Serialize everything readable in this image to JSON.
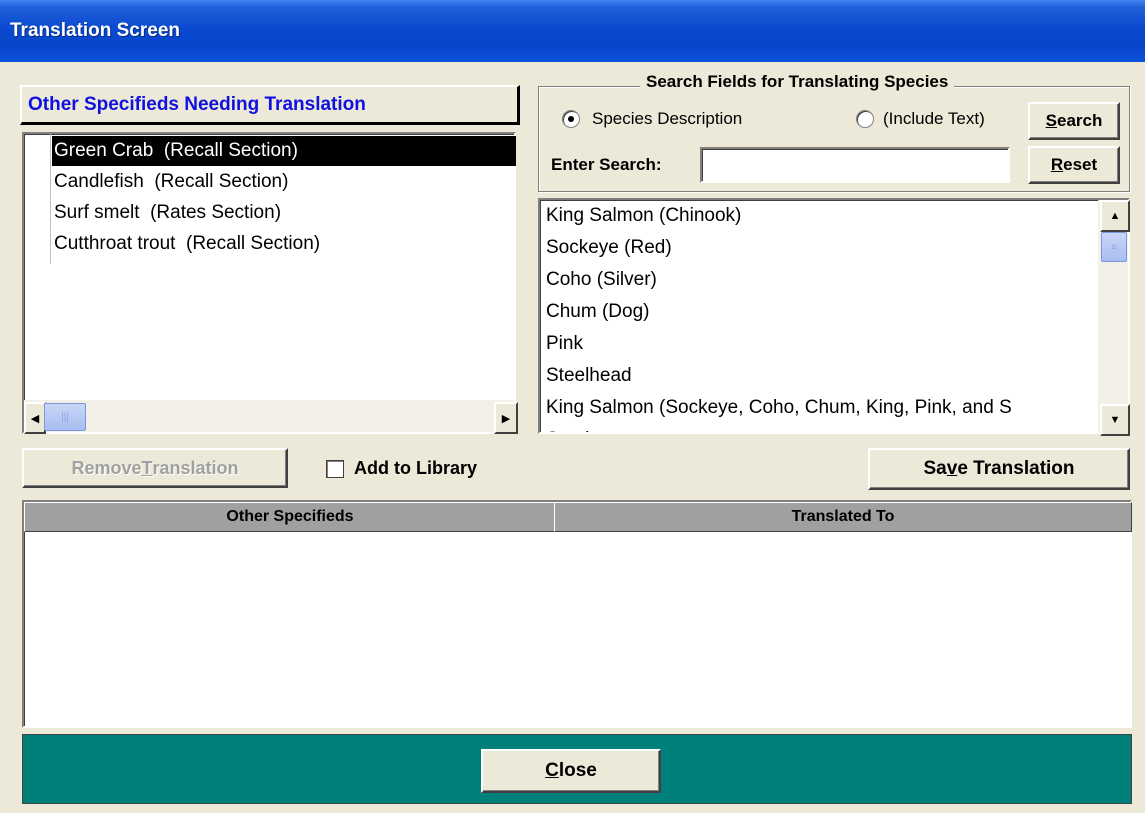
{
  "window": {
    "title": "Translation Screen"
  },
  "left_panel": {
    "header": "Other Specifieds Needing Translation",
    "items": [
      "Green Crab  (Recall Section)",
      "Candlefish  (Recall Section)",
      "Surf smelt  (Rates Section)",
      "Cutthroat trout  (Recall Section)"
    ],
    "selected_index": 0
  },
  "search": {
    "group_title": "Search Fields for Translating Species",
    "radio_species": "Species Description",
    "radio_include": "(Include Text)",
    "selected_radio": "Species Description",
    "label": "Enter Search:",
    "value": "",
    "search_button": {
      "pre": "",
      "key": "S",
      "post": "earch"
    },
    "reset_button": {
      "pre": "",
      "key": "R",
      "post": "eset"
    }
  },
  "species_list": [
    "King Salmon (Chinook)",
    "Sockeye (Red)",
    "Coho (Silver)",
    "Chum (Dog)",
    "Pink",
    "Steelhead",
    "King Salmon (Sockeye, Coho, Chum, King, Pink, and S",
    "Smelt"
  ],
  "actions": {
    "remove_button": {
      "pre": "Remove ",
      "key": "T",
      "post": "ranslation"
    },
    "remove_enabled": false,
    "add_to_library": "Add to Library",
    "add_to_library_checked": false,
    "save_button": {
      "pre": "Sa",
      "key": "v",
      "post": "e Translation"
    }
  },
  "grid": {
    "columns": [
      "Other Specifieds",
      "Translated To"
    ],
    "rows": []
  },
  "footer": {
    "close_button": {
      "pre": "",
      "key": "C",
      "post": "lose"
    }
  },
  "colors": {
    "titlebar": "#0A4AD0",
    "header_text": "#1010E0",
    "footer": "#00807A",
    "dialog": "#ECE9D8"
  }
}
